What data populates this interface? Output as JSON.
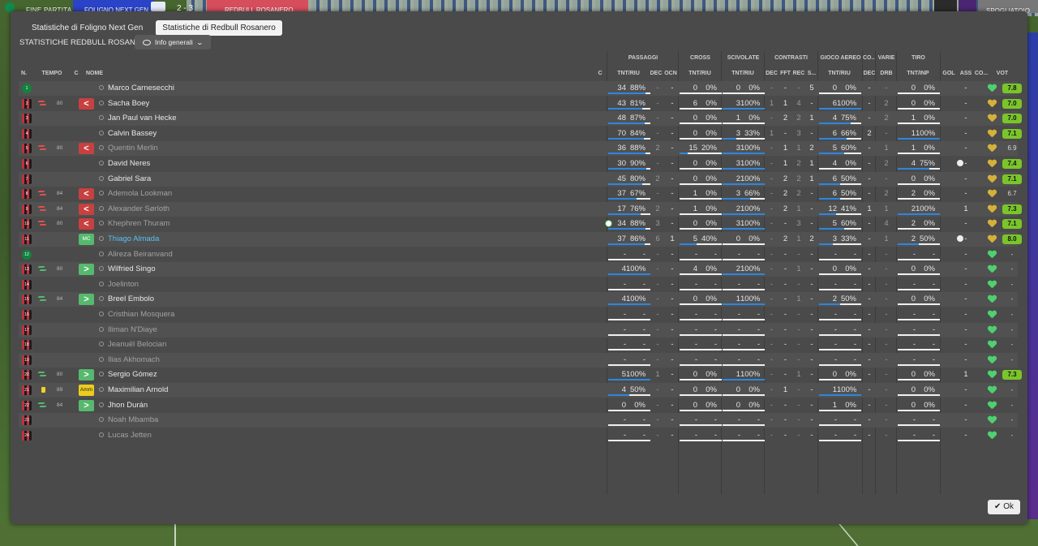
{
  "topbar": {
    "fine": "FINE PARTITA",
    "team1": "FOLIGNO NEXT GEN",
    "score": "2 - 3",
    "team2": "REDBULL ROSANERO",
    "right_btn": "SPOGLIATOIO"
  },
  "tabs": [
    {
      "label": "Statistiche di Foligno Next Gen",
      "active": false
    },
    {
      "label": "Statistiche di Redbull Rosanero",
      "active": true
    }
  ],
  "subtitle": "STATISTICHE REDBULL ROSANERO",
  "view_select": {
    "label": "Info generali"
  },
  "groups": {
    "passaggi": "PASSAGGI",
    "cross": "CROSS",
    "scivolate": "SCIVOLATE",
    "contrasti": "CONTRASTI",
    "gioco_aereo": "GIOCO AEREO",
    "co": "CO...",
    "varie": "VARIE",
    "tiro": "TIRO"
  },
  "columns": {
    "n": "N.",
    "tempo": "TEMPO",
    "c": "C",
    "nome": "NOME",
    "c2": "C",
    "pass_tnt": "TNT/RIU",
    "dec": "DEC",
    "ocn": "OCN",
    "cross_tnt": "TNT/RIU",
    "sciv_tnt": "TNT/RIU",
    "con_dec": "DEC",
    "fft": "FFT",
    "rec": "REC",
    "s": "S...",
    "aer_tnt": "TNT/RIU",
    "co_dec": "DEC",
    "drb": "DRB",
    "tiro_tnt": "TNT/INP",
    "gol": "GOL",
    "ass": "ASS",
    "co2": "CO...",
    "vot": "VOT"
  },
  "players": [
    {
      "n": "1",
      "gk": true,
      "sub": "",
      "mins": "",
      "role": "",
      "role_label": "",
      "name": "Marco Carnesecchi",
      "nstyle": "",
      "c": "",
      "p": [
        "34",
        "88%"
      ],
      "pf": 0.88,
      "dec": "-",
      "ocn": "-",
      "x": [
        "0",
        "0%"
      ],
      "xf": 0,
      "s": [
        "0",
        "0%"
      ],
      "sf": 0,
      "cd": "-",
      "ff": "-",
      "rc": "-",
      "ss": "5",
      "a": [
        "0",
        "0%"
      ],
      "af": 0,
      "cod": "-",
      "drb": "-",
      "t": [
        "0",
        "0%"
      ],
      "tf": 0,
      "gol": "",
      "ass": "-",
      "h": "g",
      "v": "7.8",
      "vg": true
    },
    {
      "n": "2",
      "gk": false,
      "sub": "out",
      "mins": "80",
      "role": "out",
      "role_label": "<",
      "name": "Sacha Boey",
      "nstyle": "",
      "c": "",
      "p": [
        "43",
        "81%"
      ],
      "pf": 0.81,
      "dec": "-",
      "ocn": "-",
      "x": [
        "6",
        "0%"
      ],
      "xf": 0,
      "s": [
        "3",
        "100%"
      ],
      "sf": 1,
      "cd": "1",
      "ff": "1",
      "rc": "4",
      "ss": "-",
      "a": [
        "6",
        "100%"
      ],
      "af": 1,
      "cod": "-",
      "drb": "2",
      "t": [
        "0",
        "0%"
      ],
      "tf": 0,
      "gol": "",
      "ass": "-",
      "h": "y",
      "v": "7.0",
      "vg": true
    },
    {
      "n": "3",
      "gk": false,
      "sub": "",
      "mins": "",
      "role": "",
      "role_label": "",
      "name": "Jan Paul van Hecke",
      "nstyle": "",
      "c": "",
      "p": [
        "48",
        "87%"
      ],
      "pf": 0.87,
      "dec": "-",
      "ocn": "-",
      "x": [
        "0",
        "0%"
      ],
      "xf": 0,
      "s": [
        "1",
        "0%"
      ],
      "sf": 0,
      "cd": "-",
      "ff": "2",
      "rc": "2",
      "ss": "1",
      "a": [
        "4",
        "75%"
      ],
      "af": 0.75,
      "cod": "-",
      "drb": "2",
      "t": [
        "1",
        "0%"
      ],
      "tf": 0,
      "gol": "",
      "ass": "-",
      "h": "y",
      "v": "7.0",
      "vg": true
    },
    {
      "n": "4",
      "gk": false,
      "sub": "",
      "mins": "",
      "role": "",
      "role_label": "",
      "name": "Calvin Bassey",
      "nstyle": "",
      "c": "",
      "p": [
        "70",
        "84%"
      ],
      "pf": 0.84,
      "dec": "-",
      "ocn": "-",
      "x": [
        "0",
        "0%"
      ],
      "xf": 0,
      "s": [
        "3",
        "33%"
      ],
      "sf": 0.33,
      "cd": "1",
      "ff": "-",
      "rc": "3",
      "ss": "-",
      "a": [
        "6",
        "66%"
      ],
      "af": 0.66,
      "cod": "2",
      "drb": "-",
      "t": [
        "1",
        "100%"
      ],
      "tf": 1,
      "gol": "",
      "ass": "-",
      "h": "y",
      "v": "7.1",
      "vg": true
    },
    {
      "n": "5",
      "gk": false,
      "sub": "out",
      "mins": "80",
      "role": "out",
      "role_label": "<",
      "name": "Quentin Merlin",
      "nstyle": "dim",
      "c": "",
      "p": [
        "36",
        "88%"
      ],
      "pf": 0.88,
      "dec": "2",
      "ocn": "-",
      "x": [
        "15",
        "20%"
      ],
      "xf": 0.2,
      "s": [
        "3",
        "100%"
      ],
      "sf": 1,
      "cd": "-",
      "ff": "1",
      "rc": "1",
      "ss": "2",
      "a": [
        "5",
        "60%"
      ],
      "af": 0.6,
      "cod": "-",
      "drb": "1",
      "t": [
        "1",
        "0%"
      ],
      "tf": 0,
      "gol": "",
      "ass": "-",
      "h": "y",
      "v": "6.9",
      "vg": false
    },
    {
      "n": "6",
      "gk": false,
      "sub": "",
      "mins": "",
      "role": "",
      "role_label": "",
      "name": "David Neres",
      "nstyle": "",
      "c": "",
      "p": [
        "30",
        "90%"
      ],
      "pf": 0.9,
      "dec": "-",
      "ocn": "-",
      "x": [
        "0",
        "0%"
      ],
      "xf": 0,
      "s": [
        "3",
        "100%"
      ],
      "sf": 1,
      "cd": "-",
      "ff": "1",
      "rc": "2",
      "ss": "1",
      "a": [
        "4",
        "0%"
      ],
      "af": 0,
      "cod": "-",
      "drb": "2",
      "t": [
        "4",
        "75%"
      ],
      "tf": 0.75,
      "gol": "ball",
      "ass": "-",
      "h": "y",
      "v": "7.4",
      "vg": true
    },
    {
      "n": "7",
      "gk": false,
      "sub": "",
      "mins": "",
      "role": "",
      "role_label": "",
      "name": "Gabriel Sara",
      "nstyle": "",
      "c": "",
      "p": [
        "45",
        "80%"
      ],
      "pf": 0.8,
      "dec": "2",
      "ocn": "-",
      "x": [
        "0",
        "0%"
      ],
      "xf": 0,
      "s": [
        "2",
        "100%"
      ],
      "sf": 1,
      "cd": "-",
      "ff": "2",
      "rc": "2",
      "ss": "1",
      "a": [
        "6",
        "50%"
      ],
      "af": 0.5,
      "cod": "-",
      "drb": "-",
      "t": [
        "0",
        "0%"
      ],
      "tf": 0,
      "gol": "",
      "ass": "-",
      "h": "y",
      "v": "7.1",
      "vg": true
    },
    {
      "n": "8",
      "gk": false,
      "sub": "out",
      "mins": "84",
      "role": "out",
      "role_label": "<",
      "name": "Ademola Lookman",
      "nstyle": "dim",
      "c": "",
      "p": [
        "37",
        "67%"
      ],
      "pf": 0.67,
      "dec": "-",
      "ocn": "-",
      "x": [
        "1",
        "0%"
      ],
      "xf": 0,
      "s": [
        "3",
        "66%"
      ],
      "sf": 0.66,
      "cd": "-",
      "ff": "2",
      "rc": "2",
      "ss": "-",
      "a": [
        "6",
        "50%"
      ],
      "af": 0.5,
      "cod": "-",
      "drb": "2",
      "t": [
        "2",
        "0%"
      ],
      "tf": 0,
      "gol": "",
      "ass": "-",
      "h": "y",
      "v": "6.7",
      "vg": false
    },
    {
      "n": "9",
      "gk": false,
      "sub": "out",
      "mins": "84",
      "role": "out",
      "role_label": "<",
      "name": "Alexander Sørloth",
      "nstyle": "dim",
      "c": "",
      "p": [
        "17",
        "76%"
      ],
      "pf": 0.76,
      "dec": "2",
      "ocn": "-",
      "x": [
        "1",
        "0%"
      ],
      "xf": 0,
      "s": [
        "2",
        "100%"
      ],
      "sf": 1,
      "cd": "-",
      "ff": "2",
      "rc": "1",
      "ss": "-",
      "a": [
        "12",
        "41%"
      ],
      "af": 0.41,
      "cod": "1",
      "drb": "1",
      "t": [
        "2",
        "100%"
      ],
      "tf": 1,
      "gol": "",
      "ass": "1",
      "h": "y",
      "v": "7.3",
      "vg": true
    },
    {
      "n": "10",
      "gk": false,
      "sub": "out",
      "mins": "80",
      "role": "out",
      "role_label": "<",
      "name": "Khephren Thuram",
      "nstyle": "dim",
      "c": "pitch",
      "p": [
        "34",
        "88%"
      ],
      "pf": 0.88,
      "dec": "3",
      "ocn": "-",
      "x": [
        "0",
        "0%"
      ],
      "xf": 0,
      "s": [
        "3",
        "100%"
      ],
      "sf": 1,
      "cd": "-",
      "ff": "-",
      "rc": "3",
      "ss": "-",
      "a": [
        "5",
        "60%"
      ],
      "af": 0.6,
      "cod": "-",
      "drb": "4",
      "t": [
        "2",
        "0%"
      ],
      "tf": 0,
      "gol": "",
      "ass": "-",
      "h": "y",
      "v": "7.1",
      "vg": true
    },
    {
      "n": "11",
      "gk": false,
      "sub": "",
      "mins": "",
      "role": "mc",
      "role_label": "MC",
      "name": "Thiago Almada",
      "nstyle": "blue",
      "c": "",
      "p": [
        "37",
        "86%"
      ],
      "pf": 0.86,
      "dec": "6",
      "ocn": "1",
      "x": [
        "5",
        "40%"
      ],
      "xf": 0.4,
      "s": [
        "0",
        "0%"
      ],
      "sf": 0,
      "cd": "-",
      "ff": "2",
      "rc": "1",
      "ss": "2",
      "a": [
        "3",
        "33%"
      ],
      "af": 0.33,
      "cod": "-",
      "drb": "1",
      "t": [
        "2",
        "50%"
      ],
      "tf": 0.5,
      "gol": "ball",
      "ass": "-",
      "h": "y",
      "v": "8.0",
      "vg": true
    },
    {
      "n": "12",
      "gk": true,
      "sub": "",
      "mins": "",
      "role": "",
      "role_label": "",
      "name": "Alireza Beiranvand",
      "nstyle": "dim",
      "c": "",
      "p": [
        "-",
        "-"
      ],
      "pf": 0,
      "dec": "-",
      "ocn": "-",
      "x": [
        "-",
        "-"
      ],
      "xf": 0,
      "s": [
        "-",
        "-"
      ],
      "sf": 0,
      "cd": "-",
      "ff": "-",
      "rc": "-",
      "ss": "-",
      "a": [
        "-",
        "-"
      ],
      "af": 0,
      "cod": "-",
      "drb": "-",
      "t": [
        "-",
        "-"
      ],
      "tf": 0,
      "gol": "",
      "ass": "-",
      "h": "g",
      "v": "-",
      "vg": false
    },
    {
      "n": "13",
      "gk": false,
      "sub": "in",
      "mins": "80",
      "role": "in",
      "role_label": ">",
      "name": "Wilfried Singo",
      "nstyle": "",
      "c": "",
      "p": [
        "4",
        "100%"
      ],
      "pf": 1,
      "dec": "-",
      "ocn": "-",
      "x": [
        "4",
        "0%"
      ],
      "xf": 0,
      "s": [
        "2",
        "100%"
      ],
      "sf": 1,
      "cd": "-",
      "ff": "-",
      "rc": "1",
      "ss": "-",
      "a": [
        "0",
        "0%"
      ],
      "af": 0,
      "cod": "-",
      "drb": "-",
      "t": [
        "0",
        "0%"
      ],
      "tf": 0,
      "gol": "",
      "ass": "-",
      "h": "g",
      "v": "-",
      "vg": false
    },
    {
      "n": "14",
      "gk": false,
      "sub": "",
      "mins": "",
      "role": "",
      "role_label": "",
      "name": "Joelinton",
      "nstyle": "dim",
      "c": "",
      "p": [
        "-",
        "-"
      ],
      "pf": 0,
      "dec": "-",
      "ocn": "-",
      "x": [
        "-",
        "-"
      ],
      "xf": 0,
      "s": [
        "-",
        "-"
      ],
      "sf": 0,
      "cd": "-",
      "ff": "-",
      "rc": "-",
      "ss": "-",
      "a": [
        "-",
        "-"
      ],
      "af": 0,
      "cod": "-",
      "drb": "-",
      "t": [
        "-",
        "-"
      ],
      "tf": 0,
      "gol": "",
      "ass": "-",
      "h": "g",
      "v": "-",
      "vg": false
    },
    {
      "n": "15",
      "gk": false,
      "sub": "in",
      "mins": "84",
      "role": "in",
      "role_label": ">",
      "name": "Breel Embolo",
      "nstyle": "",
      "c": "",
      "p": [
        "4",
        "100%"
      ],
      "pf": 1,
      "dec": "-",
      "ocn": "-",
      "x": [
        "0",
        "0%"
      ],
      "xf": 0,
      "s": [
        "1",
        "100%"
      ],
      "sf": 1,
      "cd": "-",
      "ff": "-",
      "rc": "1",
      "ss": "-",
      "a": [
        "2",
        "50%"
      ],
      "af": 0.5,
      "cod": "-",
      "drb": "-",
      "t": [
        "0",
        "0%"
      ],
      "tf": 0,
      "gol": "",
      "ass": "-",
      "h": "g",
      "v": "-",
      "vg": false
    },
    {
      "n": "16",
      "gk": false,
      "sub": "",
      "mins": "",
      "role": "",
      "role_label": "",
      "name": "Cristhian Mosquera",
      "nstyle": "dim",
      "c": "",
      "p": [
        "-",
        "-"
      ],
      "pf": 0,
      "dec": "-",
      "ocn": "-",
      "x": [
        "-",
        "-"
      ],
      "xf": 0,
      "s": [
        "-",
        "-"
      ],
      "sf": 0,
      "cd": "-",
      "ff": "-",
      "rc": "-",
      "ss": "-",
      "a": [
        "-",
        "-"
      ],
      "af": 0,
      "cod": "-",
      "drb": "-",
      "t": [
        "-",
        "-"
      ],
      "tf": 0,
      "gol": "",
      "ass": "-",
      "h": "g",
      "v": "-",
      "vg": false
    },
    {
      "n": "17",
      "gk": false,
      "sub": "",
      "mins": "",
      "role": "",
      "role_label": "",
      "name": "Iliman N'Diaye",
      "nstyle": "dim",
      "c": "",
      "p": [
        "-",
        "-"
      ],
      "pf": 0,
      "dec": "-",
      "ocn": "-",
      "x": [
        "-",
        "-"
      ],
      "xf": 0,
      "s": [
        "-",
        "-"
      ],
      "sf": 0,
      "cd": "-",
      "ff": "-",
      "rc": "-",
      "ss": "-",
      "a": [
        "-",
        "-"
      ],
      "af": 0,
      "cod": "-",
      "drb": "-",
      "t": [
        "-",
        "-"
      ],
      "tf": 0,
      "gol": "",
      "ass": "-",
      "h": "g",
      "v": "-",
      "vg": false
    },
    {
      "n": "18",
      "gk": false,
      "sub": "",
      "mins": "",
      "role": "",
      "role_label": "",
      "name": "Jeanuël Belocian",
      "nstyle": "dim",
      "c": "",
      "p": [
        "-",
        "-"
      ],
      "pf": 0,
      "dec": "-",
      "ocn": "-",
      "x": [
        "-",
        "-"
      ],
      "xf": 0,
      "s": [
        "-",
        "-"
      ],
      "sf": 0,
      "cd": "-",
      "ff": "-",
      "rc": "-",
      "ss": "-",
      "a": [
        "-",
        "-"
      ],
      "af": 0,
      "cod": "-",
      "drb": "-",
      "t": [
        "-",
        "-"
      ],
      "tf": 0,
      "gol": "",
      "ass": "-",
      "h": "g",
      "v": "-",
      "vg": false
    },
    {
      "n": "19",
      "gk": false,
      "sub": "",
      "mins": "",
      "role": "",
      "role_label": "",
      "name": "Ilias Akhomach",
      "nstyle": "dim",
      "c": "",
      "p": [
        "-",
        "-"
      ],
      "pf": 0,
      "dec": "-",
      "ocn": "-",
      "x": [
        "-",
        "-"
      ],
      "xf": 0,
      "s": [
        "-",
        "-"
      ],
      "sf": 0,
      "cd": "-",
      "ff": "-",
      "rc": "-",
      "ss": "-",
      "a": [
        "-",
        "-"
      ],
      "af": 0,
      "cod": "-",
      "drb": "-",
      "t": [
        "-",
        "-"
      ],
      "tf": 0,
      "gol": "",
      "ass": "-",
      "h": "g",
      "v": "-",
      "vg": false
    },
    {
      "n": "20",
      "gk": false,
      "sub": "in",
      "mins": "80",
      "role": "in",
      "role_label": ">",
      "name": "Sergio Gómez",
      "nstyle": "",
      "c": "",
      "p": [
        "5",
        "100%"
      ],
      "pf": 1,
      "dec": "1",
      "ocn": "-",
      "x": [
        "0",
        "0%"
      ],
      "xf": 0,
      "s": [
        "1",
        "100%"
      ],
      "sf": 1,
      "cd": "-",
      "ff": "-",
      "rc": "1",
      "ss": "-",
      "a": [
        "0",
        "0%"
      ],
      "af": 0,
      "cod": "-",
      "drb": "-",
      "t": [
        "0",
        "0%"
      ],
      "tf": 0,
      "gol": "",
      "ass": "1",
      "h": "g",
      "v": "7.3",
      "vg": true
    },
    {
      "n": "21",
      "gk": false,
      "sub": "card",
      "mins": "89",
      "role": "amm",
      "role_label": "Amm",
      "name": "Maximilian Arnold",
      "nstyle": "",
      "c": "",
      "p": [
        "4",
        "50%"
      ],
      "pf": 0.5,
      "dec": "-",
      "ocn": "-",
      "x": [
        "0",
        "0%"
      ],
      "xf": 0,
      "s": [
        "0",
        "0%"
      ],
      "sf": 0,
      "cd": "-",
      "ff": "1",
      "rc": "-",
      "ss": "-",
      "a": [
        "1",
        "100%"
      ],
      "af": 1,
      "cod": "-",
      "drb": "-",
      "t": [
        "0",
        "0%"
      ],
      "tf": 0,
      "gol": "",
      "ass": "-",
      "h": "g",
      "v": "-",
      "vg": false
    },
    {
      "n": "22",
      "gk": false,
      "sub": "in",
      "mins": "84",
      "role": "in",
      "role_label": ">",
      "name": "Jhon Durán",
      "nstyle": "",
      "c": "",
      "p": [
        "0",
        "0%"
      ],
      "pf": 0,
      "dec": "-",
      "ocn": "-",
      "x": [
        "0",
        "0%"
      ],
      "xf": 0,
      "s": [
        "0",
        "0%"
      ],
      "sf": 0,
      "cd": "-",
      "ff": "-",
      "rc": "-",
      "ss": "-",
      "a": [
        "1",
        "0%"
      ],
      "af": 0,
      "cod": "-",
      "drb": "-",
      "t": [
        "0",
        "0%"
      ],
      "tf": 0,
      "gol": "",
      "ass": "-",
      "h": "g",
      "v": "-",
      "vg": false
    },
    {
      "n": "23",
      "gk": false,
      "sub": "",
      "mins": "",
      "role": "",
      "role_label": "",
      "name": "Noah Mbamba",
      "nstyle": "dim",
      "c": "",
      "p": [
        "-",
        "-"
      ],
      "pf": 0,
      "dec": "-",
      "ocn": "-",
      "x": [
        "-",
        "-"
      ],
      "xf": 0,
      "s": [
        "-",
        "-"
      ],
      "sf": 0,
      "cd": "-",
      "ff": "-",
      "rc": "-",
      "ss": "-",
      "a": [
        "-",
        "-"
      ],
      "af": 0,
      "cod": "-",
      "drb": "-",
      "t": [
        "-",
        "-"
      ],
      "tf": 0,
      "gol": "",
      "ass": "-",
      "h": "g",
      "v": "-",
      "vg": false
    },
    {
      "n": "24",
      "gk": false,
      "sub": "",
      "mins": "",
      "role": "",
      "role_label": "",
      "name": "Lucas Jetten",
      "nstyle": "dim",
      "c": "",
      "p": [
        "-",
        "-"
      ],
      "pf": 0,
      "dec": "-",
      "ocn": "-",
      "x": [
        "-",
        "-"
      ],
      "xf": 0,
      "s": [
        "-",
        "-"
      ],
      "sf": 0,
      "cd": "-",
      "ff": "-",
      "rc": "-",
      "ss": "-",
      "a": [
        "-",
        "-"
      ],
      "af": 0,
      "cod": "-",
      "drb": "-",
      "t": [
        "-",
        "-"
      ],
      "tf": 0,
      "gol": "",
      "ass": "-",
      "h": "g",
      "v": "-",
      "vg": false
    }
  ],
  "ok_label": "Ok"
}
